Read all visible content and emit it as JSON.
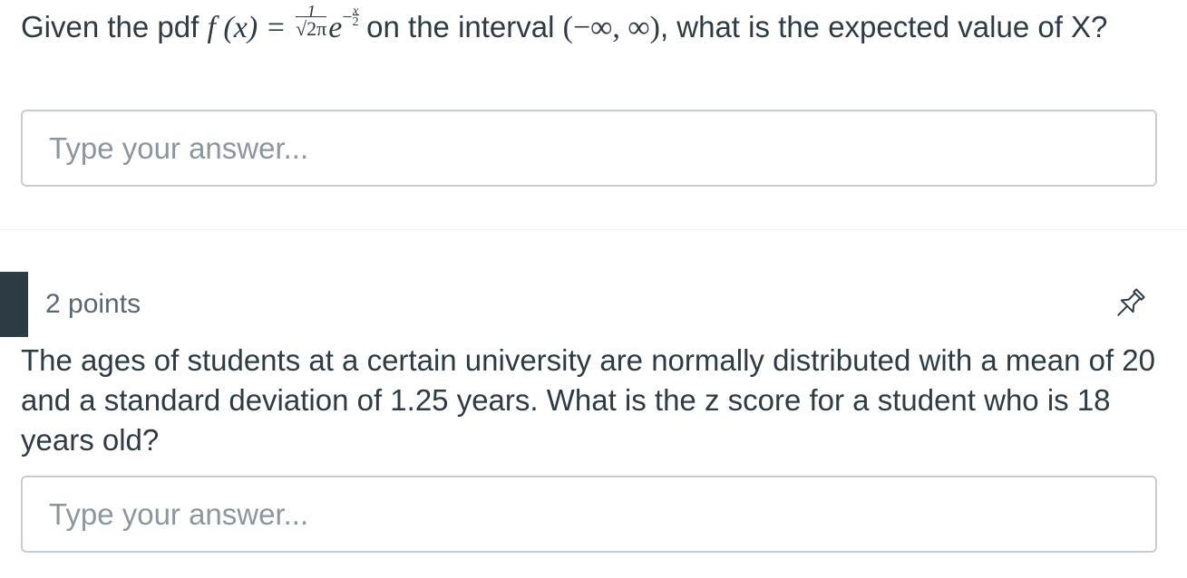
{
  "question1": {
    "text_before": "Given the pdf",
    "formula": {
      "lhs": "f (x) =",
      "numerator": "1",
      "denominator": "√2π",
      "base": "e",
      "exponent_sign": "−",
      "exponent_num": "x",
      "exponent_den": "2"
    },
    "text_middle": "on the interval",
    "interval": "(−∞, ∞)",
    "text_after": ", what is the expected value of X?",
    "answer_placeholder": "Type your answer...",
    "answer_value": ""
  },
  "question2": {
    "points": "2 points",
    "text": "The ages of students at a certain university are normally distributed with a mean of 20 and a standard deviation of 1.25 years.  What is the z score for a student who is 18 years old?",
    "answer_placeholder": "Type your answer...",
    "answer_value": ""
  },
  "icons": {
    "pin": "pin-icon"
  },
  "colors": {
    "text": "#2d3b45",
    "muted_text": "#5a6770",
    "placeholder": "#8b969e",
    "border": "#c7cdd1",
    "marker": "#2d3b45"
  }
}
